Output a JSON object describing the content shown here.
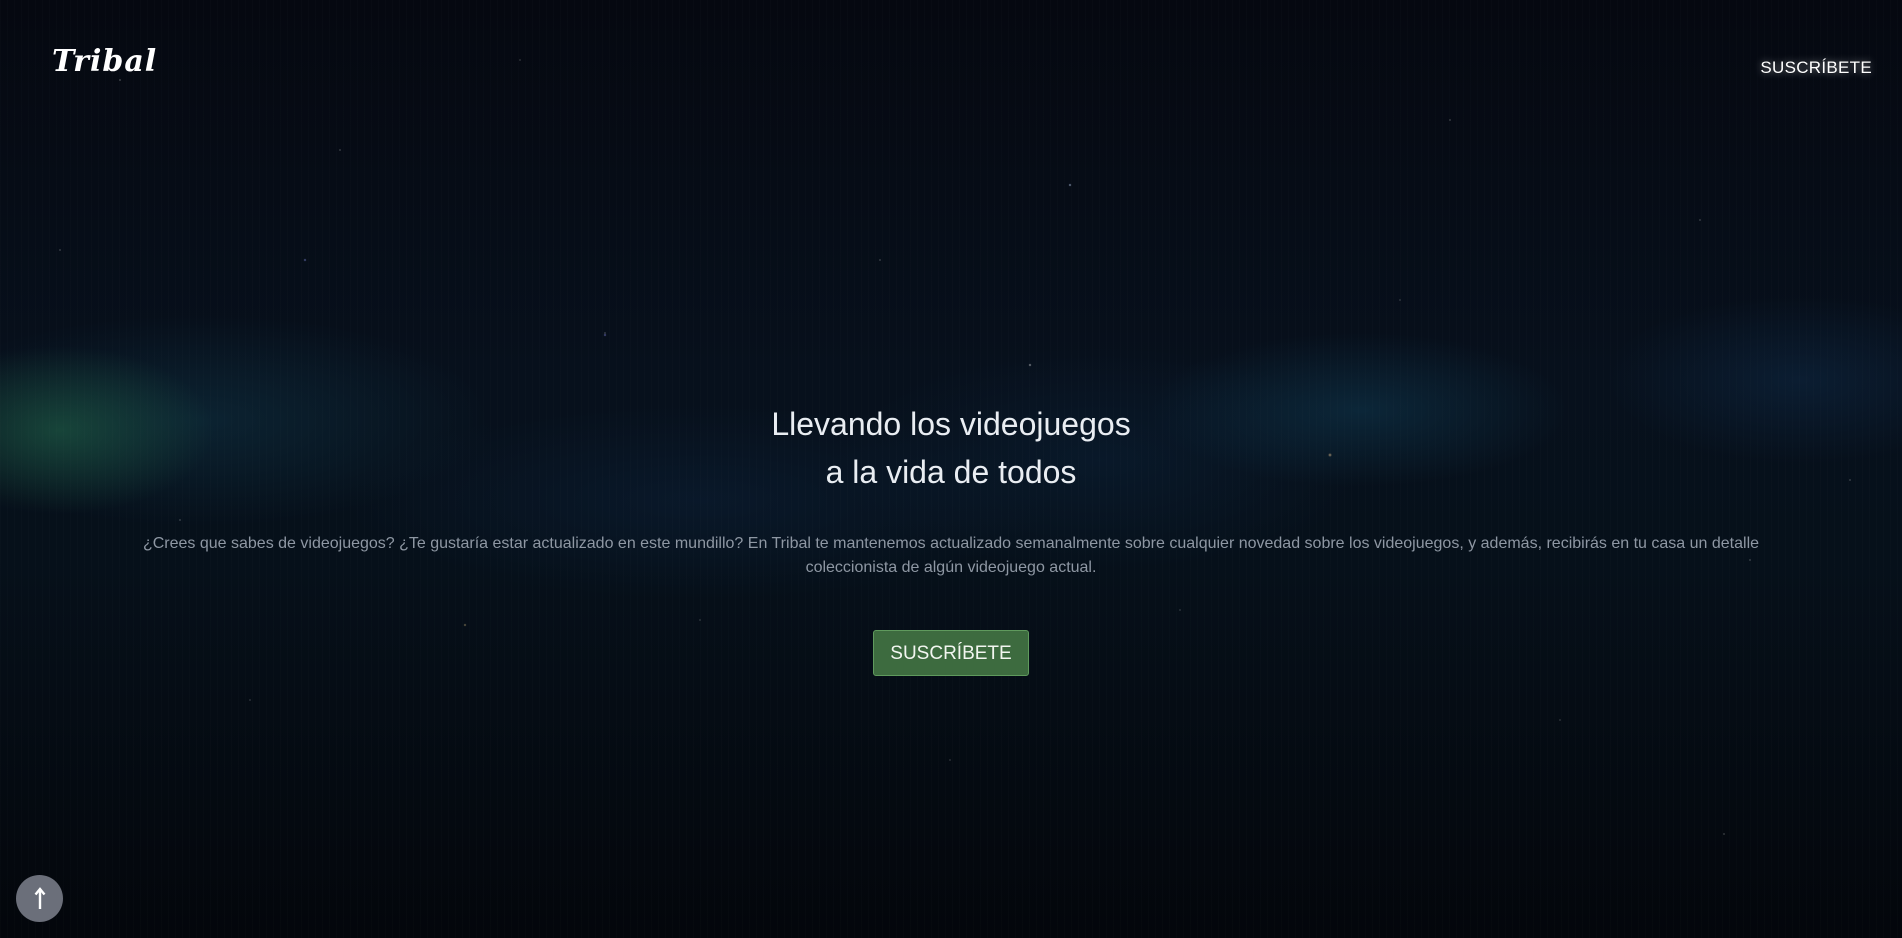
{
  "navbar": {
    "logo_text": "Tribal",
    "subscribe_link": "SUSCRÍBETE"
  },
  "hero": {
    "title_line_1": "Llevando los videojuegos",
    "title_line_2": "a la vida de todos",
    "description": "¿Crees que sabes de videojuegos? ¿Te gustaría estar actualizado en este mundillo? En Tribal te mantenemos actualizado semanalmente sobre cualquier novedad sobre los videojuegos, y además, recibirás en tu casa un detalle coleccionista de algún videojuego actual.",
    "cta_label": "SUSCRÍBETE"
  },
  "scroll_top": {
    "icon": "arrow-up-icon"
  },
  "colors": {
    "background": "#04070d",
    "cta_background": "#3d6b3f",
    "cta_border": "#5f9a5d",
    "scroll_top_background": "#6b6f7a",
    "body_text": "#8e97a3"
  }
}
